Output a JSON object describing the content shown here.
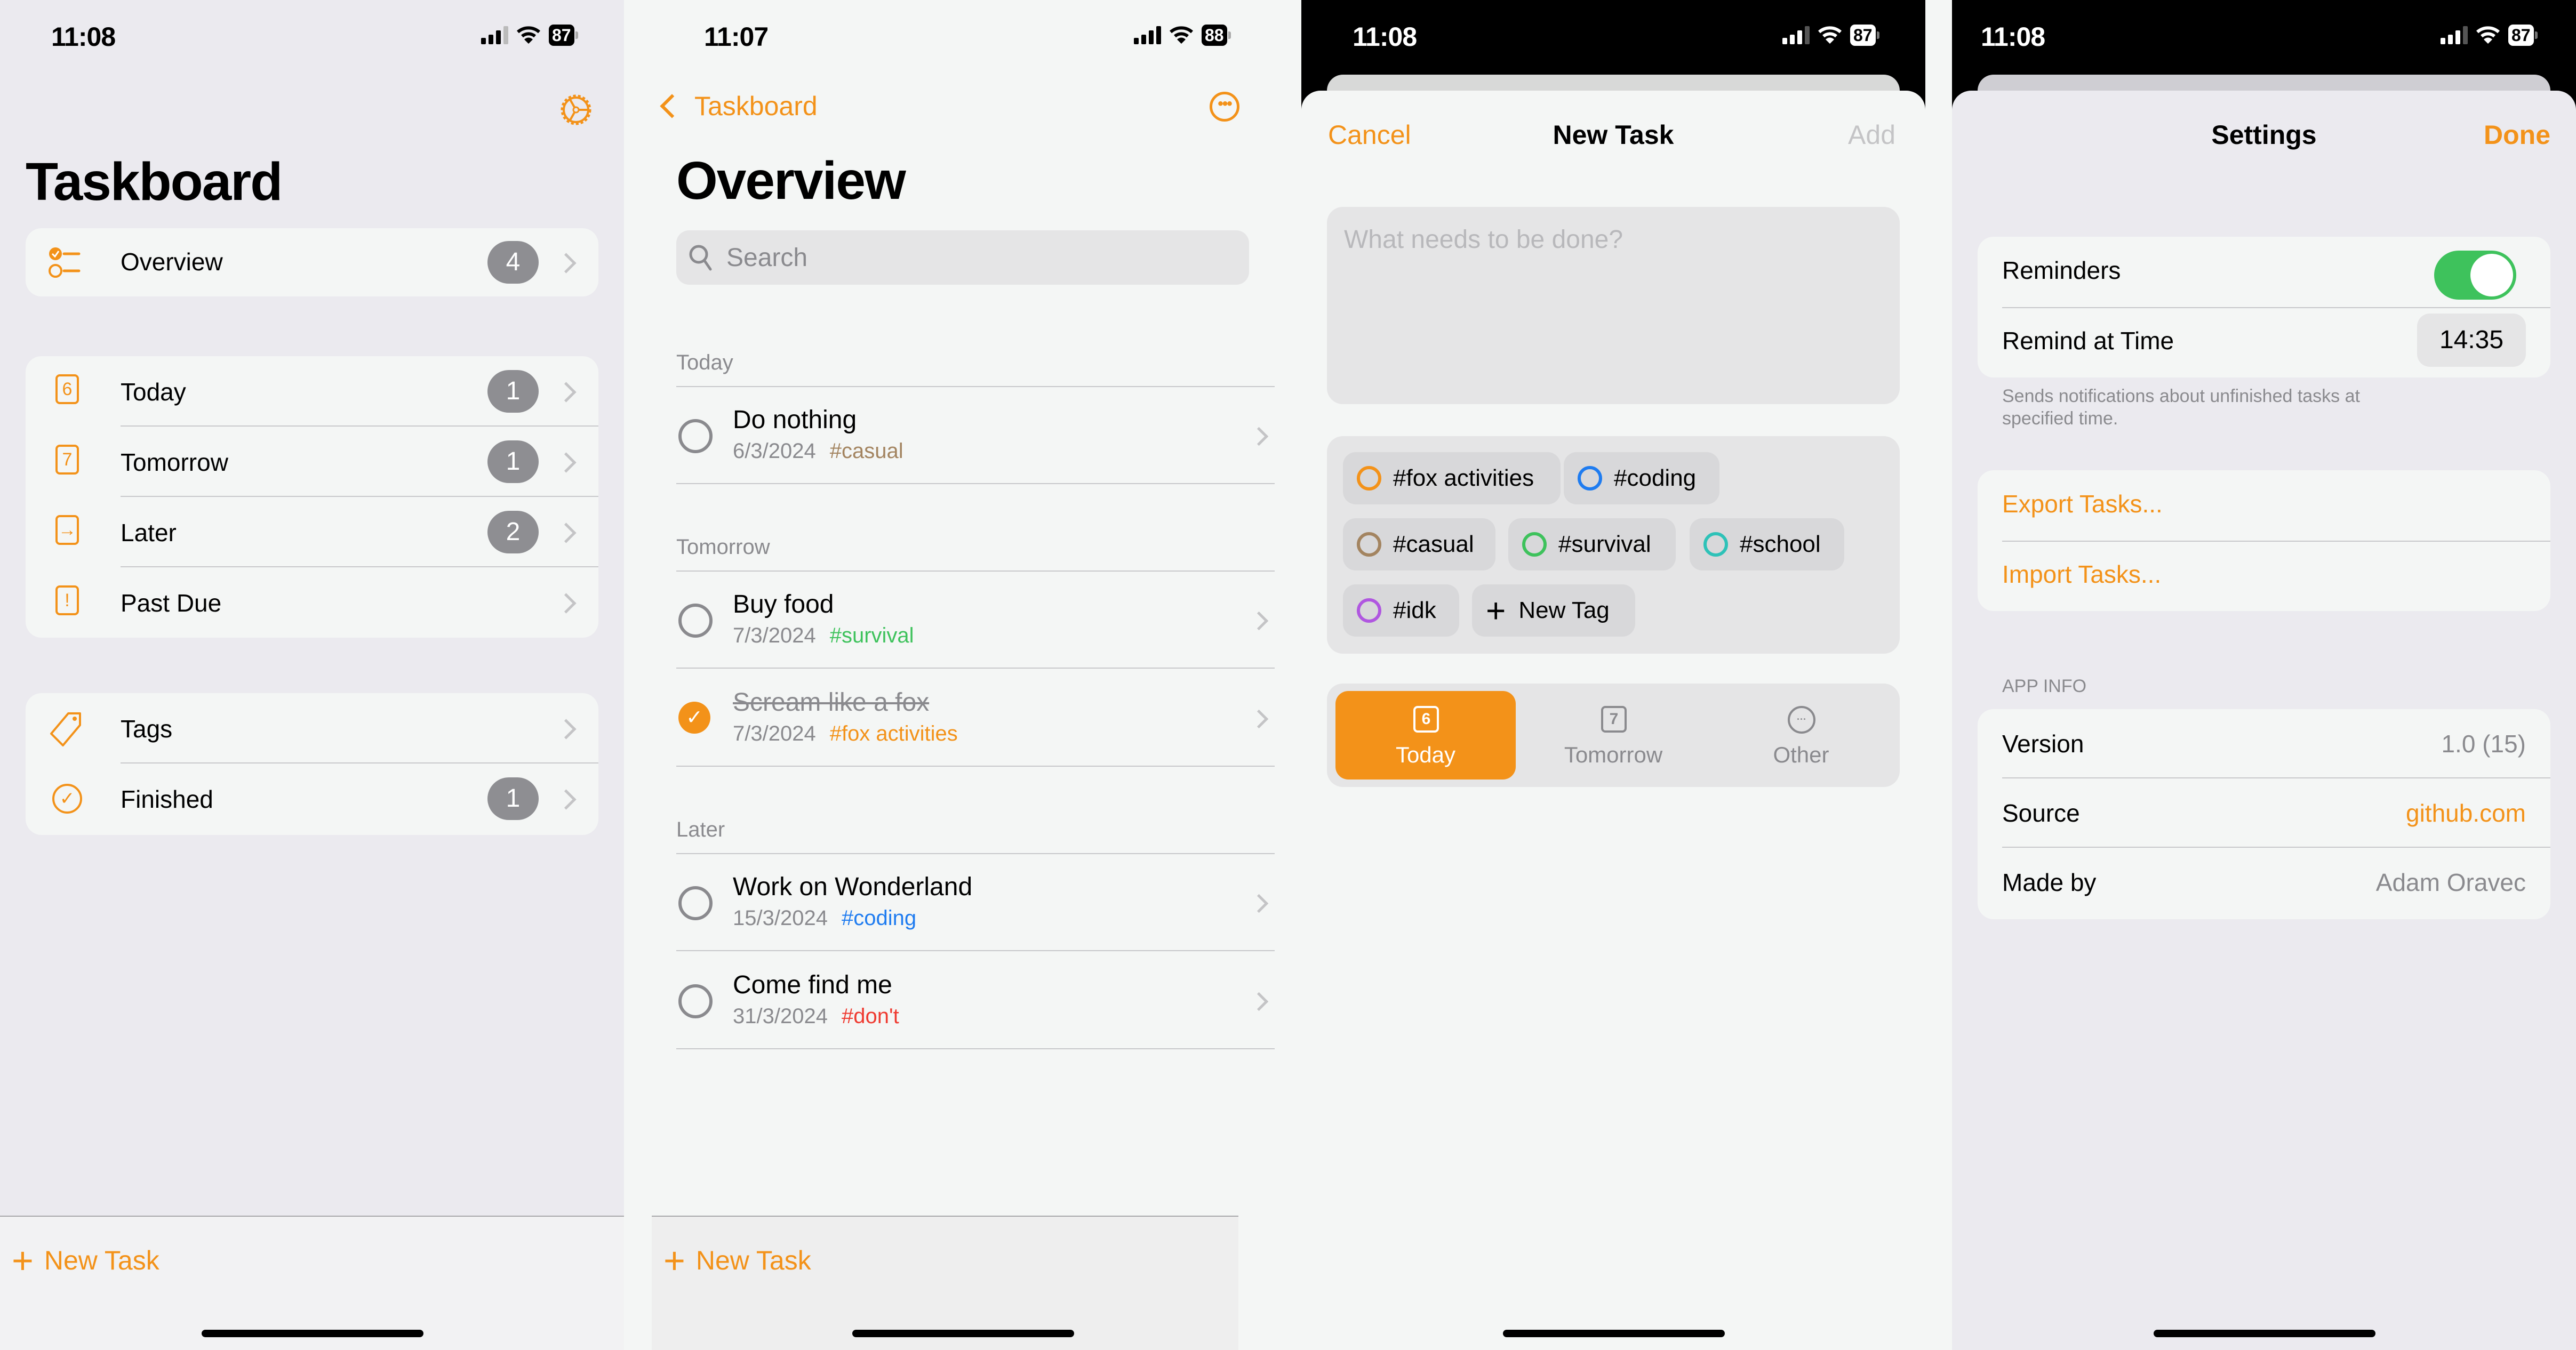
{
  "colors": {
    "accent": "#f39219",
    "badge": "#8e8e92",
    "toggle_on": "#3ec25c",
    "tag_casual": "#a38460",
    "tag_survival": "#3ec25c",
    "tag_fox_activities": "#f39219",
    "tag_coding": "#1f7cf0",
    "tag_dont": "#ef3a30",
    "tag_school": "#2ec2b8",
    "tag_idk": "#b057e0"
  },
  "screens": [
    {
      "status_bar": {
        "time": "11:08",
        "battery": "87"
      },
      "title": "Taskboard",
      "settings_icon": "gear-icon",
      "overview": {
        "label": "Overview",
        "count": "4",
        "icon": "checklist-icon"
      },
      "groups": [
        {
          "label": "Today",
          "count": "1",
          "icon": "calendar-6-icon",
          "glyph": "6"
        },
        {
          "label": "Tomorrow",
          "count": "1",
          "icon": "calendar-7-icon",
          "glyph": "7"
        },
        {
          "label": "Later",
          "count": "2",
          "icon": "arrow-right-square-icon",
          "glyph": "→"
        },
        {
          "label": "Past Due",
          "count": "",
          "icon": "exclamation-square-icon",
          "glyph": "!"
        }
      ],
      "extras": [
        {
          "label": "Tags",
          "count": "",
          "icon": "tag-icon"
        },
        {
          "label": "Finished",
          "count": "1",
          "icon": "checkmark-circle-icon"
        }
      ],
      "new_task_label": "New Task"
    },
    {
      "status_bar": {
        "time": "11:07",
        "battery": "88"
      },
      "back_label": "Taskboard",
      "title": "Overview",
      "search_placeholder": "Search",
      "sections": [
        {
          "header": "Today",
          "tasks": [
            {
              "title": "Do nothing",
              "date": "6/3/2024",
              "tag": "#casual",
              "tag_color": "#a38460",
              "done": false
            }
          ]
        },
        {
          "header": "Tomorrow",
          "tasks": [
            {
              "title": "Buy food",
              "date": "7/3/2024",
              "tag": "#survival",
              "tag_color": "#3ec25c",
              "done": false
            },
            {
              "title": "Scream like a fox",
              "date": "7/3/2024",
              "tag": "#fox activities",
              "tag_color": "#f39219",
              "done": true
            }
          ]
        },
        {
          "header": "Later",
          "tasks": [
            {
              "title": "Work on Wonderland",
              "date": "15/3/2024",
              "tag": "#coding",
              "tag_color": "#1f7cf0",
              "done": false
            },
            {
              "title": "Come find me",
              "date": "31/3/2024",
              "tag": "#don't",
              "tag_color": "#ef3a30",
              "done": false
            }
          ]
        }
      ],
      "new_task_label": "New Task"
    },
    {
      "status_bar": {
        "time": "11:08",
        "battery": "87"
      },
      "cancel_label": "Cancel",
      "title": "New Task",
      "add_label": "Add",
      "task_placeholder": "What needs to be done?",
      "tags": [
        {
          "label": "#fox activities",
          "color": "#f39219"
        },
        {
          "label": "#coding",
          "color": "#1f7cf0"
        },
        {
          "label": "#casual",
          "color": "#a38460"
        },
        {
          "label": "#survival",
          "color": "#3ec25c"
        },
        {
          "label": "#school",
          "color": "#2ec2b8"
        },
        {
          "label": "#idk",
          "color": "#b057e0"
        }
      ],
      "new_tag_label": "New Tag",
      "due_options": [
        {
          "label": "Today",
          "glyph": "6",
          "selected": true
        },
        {
          "label": "Tomorrow",
          "glyph": "7",
          "selected": false
        },
        {
          "label": "Other",
          "glyph": "···",
          "selected": false
        }
      ]
    },
    {
      "status_bar": {
        "time": "11:08",
        "battery": "87"
      },
      "title": "Settings",
      "done_label": "Done",
      "reminders_label": "Reminders",
      "reminders_on": true,
      "remind_time_label": "Remind at Time",
      "remind_time_value": "14:35",
      "reminder_footer": "Sends notifications about unfinished tasks at specified time.",
      "export_label": "Export Tasks...",
      "import_label": "Import Tasks...",
      "app_info_header": "APP INFO",
      "info_rows": [
        {
          "label": "Version",
          "value": "1.0 (15)",
          "link": false
        },
        {
          "label": "Source",
          "value": "github.com",
          "link": true
        },
        {
          "label": "Made by",
          "value": "Adam Oravec",
          "link": false
        }
      ]
    }
  ]
}
